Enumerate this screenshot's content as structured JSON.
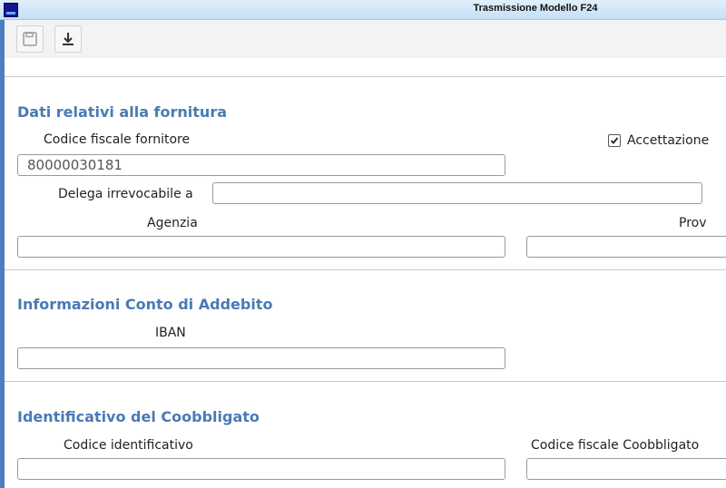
{
  "window": {
    "title": "Trasmissione Modello F24"
  },
  "toolbar": {
    "buttons": [
      {
        "icon": "save-icon"
      },
      {
        "icon": "download-icon"
      }
    ]
  },
  "fornitura": {
    "title": "Dati relativi alla fornitura",
    "codice_fiscale_label": "Codice fiscale fornitore",
    "codice_fiscale_value": "80000030181",
    "accettazione_label": "Accettazione",
    "accettazione_checked": true,
    "delega_label": "Delega irrevocabile a",
    "delega_value": "",
    "agenzia_label": "Agenzia",
    "agenzia_value": "",
    "prov_label": "Prov",
    "prov_value": ""
  },
  "conto": {
    "title": "Informazioni Conto di Addebito",
    "iban_label": "IBAN",
    "iban_value": ""
  },
  "coobbligato": {
    "title": "Identificativo del Coobbligato",
    "codice_identificativo_label": "Codice identificativo",
    "codice_identificativo_value": "",
    "codice_fiscale_label": "Codice fiscale Coobbligato",
    "codice_fiscale_value": ""
  },
  "colors": {
    "section_title": "#4a7ab5",
    "titlebar": "#c6e0f6",
    "left_edge": "#4d7fbf"
  }
}
